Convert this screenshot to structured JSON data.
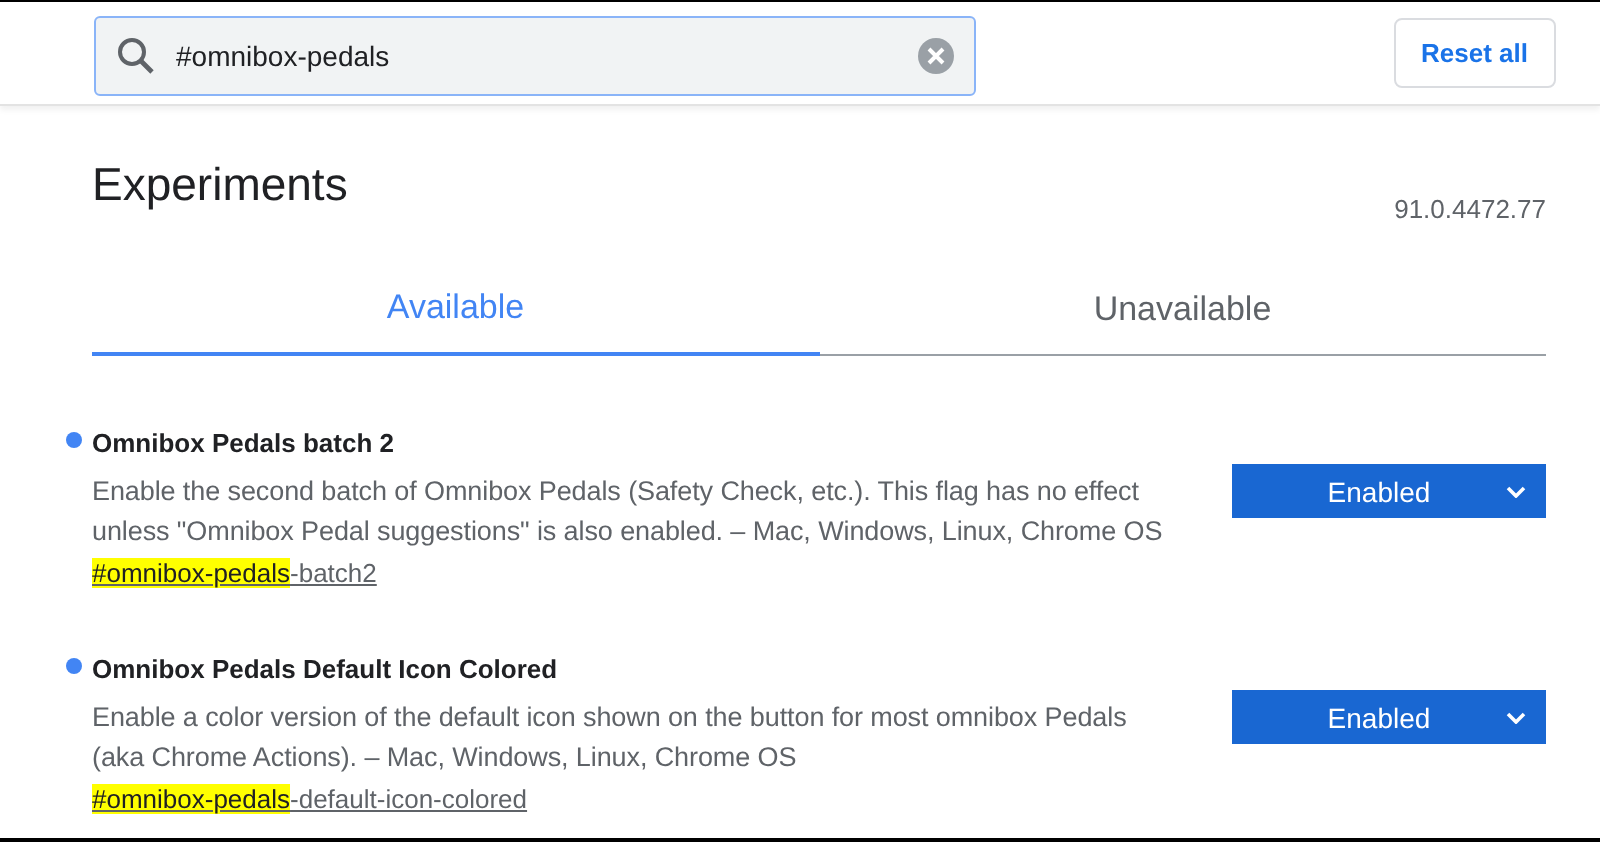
{
  "search": {
    "value": "#omnibox-pedals"
  },
  "reset_button": "Reset all",
  "title": "Experiments",
  "version": "91.0.4472.77",
  "tabs": [
    {
      "label": "Available",
      "selected": true
    },
    {
      "label": "Unavailable",
      "selected": false
    }
  ],
  "flags": [
    {
      "name": "Omnibox Pedals batch 2",
      "description": "Enable the second batch of Omnibox Pedals (Safety Check, etc.). This flag has no effect unless \"Omnibox Pedal suggestions\" is also enabled. – Mac, Windows, Linux, Chrome OS",
      "anchor_match": "#omnibox-pedals",
      "anchor_rest": "-batch2",
      "value": "Enabled",
      "modified": true
    },
    {
      "name": "Omnibox Pedals Default Icon Colored",
      "description": "Enable a color version of the default icon shown on the button for most omnibox Pedals (aka Chrome Actions). – Mac, Windows, Linux, Chrome OS",
      "anchor_match": "#omnibox-pedals",
      "anchor_rest": "-default-icon-colored",
      "value": "Enabled",
      "modified": true
    }
  ]
}
